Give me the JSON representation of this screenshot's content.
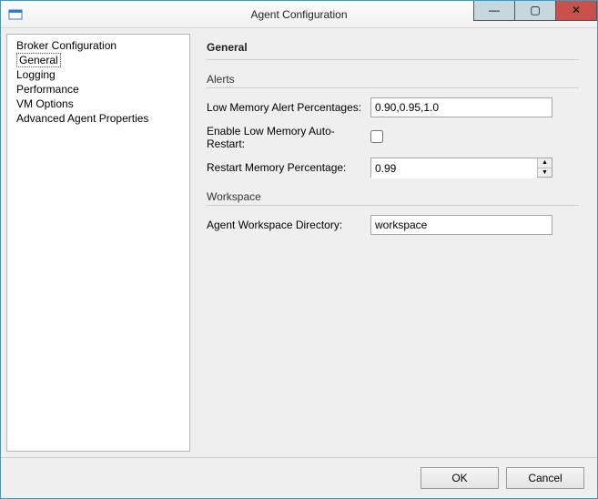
{
  "window": {
    "title": "Agent Configuration"
  },
  "sidebar": {
    "items": [
      {
        "label": "Broker Configuration"
      },
      {
        "label": "General"
      },
      {
        "label": "Logging"
      },
      {
        "label": "Performance"
      },
      {
        "label": "VM Options"
      },
      {
        "label": "Advanced Agent Properties"
      }
    ],
    "selected_index": 1
  },
  "page": {
    "title": "General",
    "groups": {
      "alerts": {
        "header": "Alerts",
        "low_mem_pct_label": "Low Memory Alert Percentages:",
        "low_mem_pct_value": "0.90,0.95,1.0",
        "enable_autorestart_label": "Enable Low Memory Auto-Restart:",
        "enable_autorestart_checked": false,
        "restart_pct_label": "Restart Memory Percentage:",
        "restart_pct_value": "0.99"
      },
      "workspace": {
        "header": "Workspace",
        "dir_label": "Agent Workspace Directory:",
        "dir_value": "workspace"
      }
    }
  },
  "footer": {
    "ok_label": "OK",
    "cancel_label": "Cancel"
  }
}
